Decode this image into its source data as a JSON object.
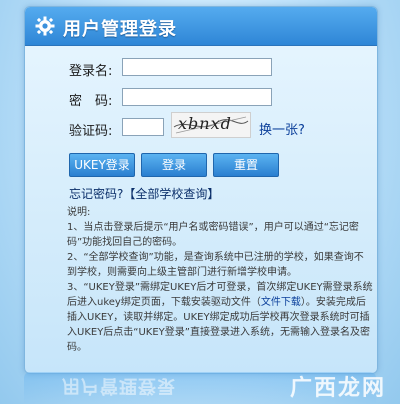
{
  "header": {
    "title": "用户管理登录"
  },
  "form": {
    "username_label": "登录名:",
    "password_label": "密　码:",
    "captcha_label": "验证码:",
    "captcha_text": "xbnxd",
    "refresh_label": "换一张?"
  },
  "buttons": {
    "ukey_login": "UKEY登录",
    "login": "登录",
    "reset": "重置"
  },
  "forgot": {
    "text": "忘记密码?【全部学校查询】"
  },
  "notes": {
    "title": "说明:",
    "lines": [
      "1、当点击登录后提示“用户名或密码错误”，用户可以通过“忘记密码”功能找回自己的密码。",
      "2、“全部学校查询”功能，是查询系统中已注册的学校，如果查询不到学校，则需要向上级主管部门进行新增学校申请。",
      "3、“UKEY登录”需绑定UKEY后才可登录，首次绑定UKEY需登录系统后进入ukey绑定页面，下载安装驱动文件（",
      "文件下载",
      "）。安装完成后插入UKEY，读取并绑定。UKEY绑定成功后学校再次登录系统时可插入UKEY后点击“UKEY登录”直接登录进入系统，无需输入登录名及密码。"
    ]
  },
  "reflection": {
    "title": "用户管理登录"
  },
  "watermark": {
    "text": "广西龙网"
  }
}
